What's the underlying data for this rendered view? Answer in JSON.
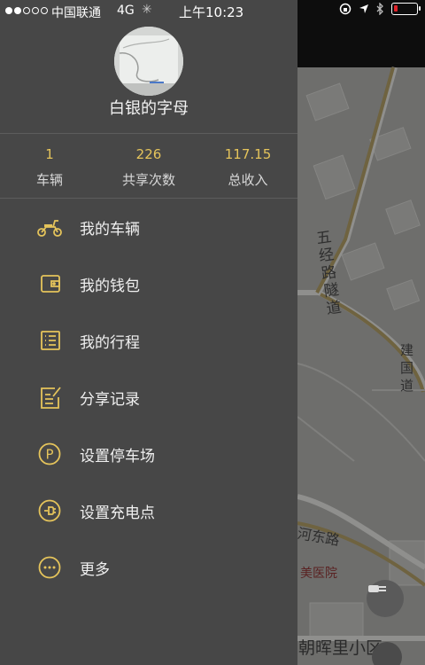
{
  "status_bar": {
    "carrier": "中国联通",
    "network": "4G",
    "time": "上午10:23",
    "battery_level": 0.15
  },
  "profile": {
    "username": "白银的字母"
  },
  "stats": [
    {
      "value": "1",
      "label": "车辆"
    },
    {
      "value": "226",
      "label": "共享次数"
    },
    {
      "value": "117.15",
      "label": "总收入"
    }
  ],
  "menu": [
    {
      "label": "我的车辆",
      "icon": "scooter-icon"
    },
    {
      "label": "我的钱包",
      "icon": "wallet-icon"
    },
    {
      "label": "我的行程",
      "icon": "list-icon"
    },
    {
      "label": "分享记录",
      "icon": "note-edit-icon"
    },
    {
      "label": "设置停车场",
      "icon": "parking-icon"
    },
    {
      "label": "设置充电点",
      "icon": "charging-plug-icon"
    },
    {
      "label": "更多",
      "icon": "more-icon"
    }
  ],
  "map": {
    "labels": [
      "五经路隧道",
      "建国道",
      "河东路",
      "美医院",
      "朝晖里小区"
    ]
  },
  "colors": {
    "accent": "#e5c45b",
    "drawer": "#474747",
    "map": "#6e6e6c"
  }
}
